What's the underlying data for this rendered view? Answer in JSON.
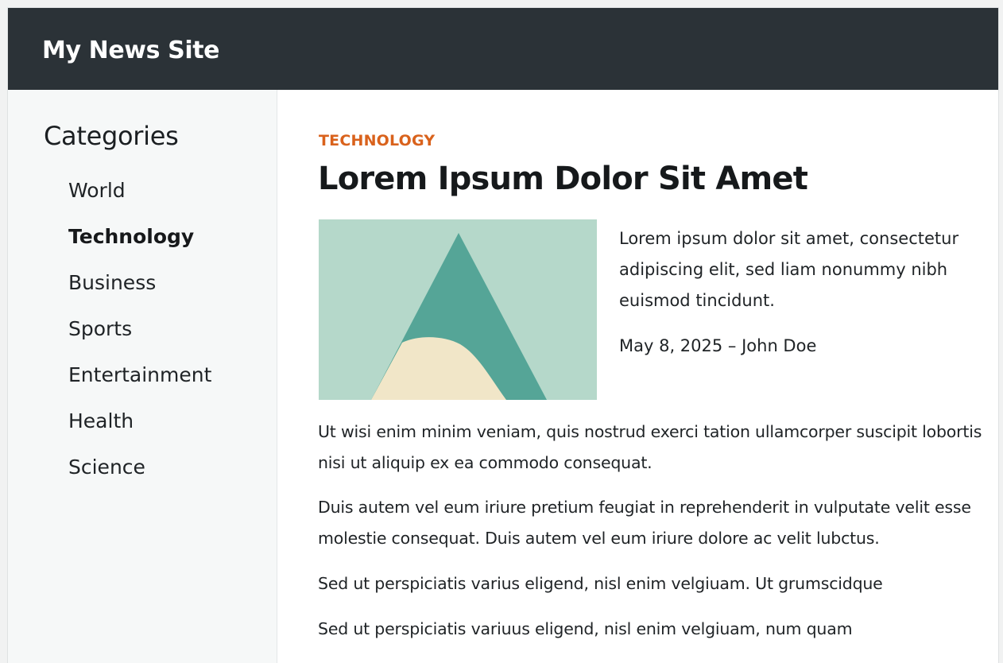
{
  "header": {
    "site_title": "My News Site"
  },
  "sidebar": {
    "heading": "Categories",
    "items": [
      {
        "label": "World",
        "active": false
      },
      {
        "label": "Technology",
        "active": true
      },
      {
        "label": "Business",
        "active": false
      },
      {
        "label": "Sports",
        "active": false
      },
      {
        "label": "Entertainment",
        "active": false
      },
      {
        "label": "Health",
        "active": false
      },
      {
        "label": "Science",
        "active": false
      }
    ]
  },
  "article": {
    "category": "TECHNOLOGY",
    "title": "Lorem Ipsum Dolor Sit Amet",
    "summary": "Lorem ipsum dolor sit amet, consectetur adipiscing elit, sed liam nonummy nibh euismod tincidunt.",
    "byline": "May 8, 2025 – John Doe",
    "paragraphs": [
      "Ut wisi enim minim veniam, quis nostrud exerci tation ullamcorper suscipit lobortis nisi ut aliquip ex ea commodo consequat.",
      "Duis autem vel eum iriure pretium feugiat in reprehenderit in vulputate velit esse molestie consequat. Duis autem vel eum iriure dolore ac velit lubctus.",
      "Sed ut perspiciatis varius eligend, nisl enim velgiuam. Ut grumscidque",
      "Sed ut perspiciatis variuus eligend,  nisl enim velgiuam, num quam"
    ]
  },
  "colors": {
    "header_bg": "#2b3237",
    "accent": "#d9621c",
    "sidebar_bg": "#f6f8f8",
    "thumb_bg": "#b5d8ca",
    "thumb_mountain": "#55a597",
    "thumb_hill": "#f1e6c8"
  }
}
